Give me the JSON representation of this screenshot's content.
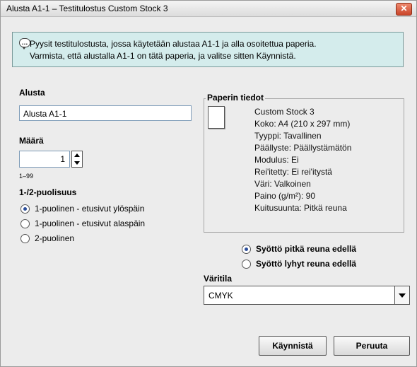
{
  "window": {
    "title": "Alusta A1-1 – Testitulostus Custom Stock 3",
    "close_label": "✕"
  },
  "info": {
    "line1": "Pyysit testitulostusta, jossa käytetään alustaa A1-1 ja alla osoitettua paperia.",
    "line2": "Varmista, että alustalla A1-1 on tätä paperia, ja valitse sitten Käynnistä."
  },
  "tray": {
    "label": "Alusta",
    "value": "Alusta A1-1"
  },
  "quantity": {
    "label": "Määrä",
    "value": "1",
    "range": "1–99"
  },
  "sides": {
    "label": "1-/2-puolisuus",
    "options": [
      {
        "label": "1-puolinen - etusivut ylöspäin",
        "selected": true
      },
      {
        "label": "1-puolinen - etusivut alaspäin",
        "selected": false
      },
      {
        "label": "2-puolinen",
        "selected": false
      }
    ]
  },
  "paper": {
    "legend": "Paperin tiedot",
    "lines": [
      "Custom Stock 3",
      "Koko: A4 (210 x 297 mm)",
      "Tyyppi: Tavallinen",
      "Päällyste: Päällystämätön",
      "Modulus: Ei",
      "Rei'itetty: Ei rei'itystä",
      "Väri: Valkoinen",
      "Paino (g/m²): 90",
      "Kuitusuunta: Pitkä reuna"
    ]
  },
  "feed": {
    "options": [
      {
        "label": "Syöttö pitkä reuna edellä",
        "selected": true
      },
      {
        "label": "Syöttö lyhyt reuna edellä",
        "selected": false
      }
    ]
  },
  "color_mode": {
    "label": "Väritila",
    "value": "CMYK"
  },
  "buttons": {
    "start": "Käynnistä",
    "cancel": "Peruuta"
  }
}
